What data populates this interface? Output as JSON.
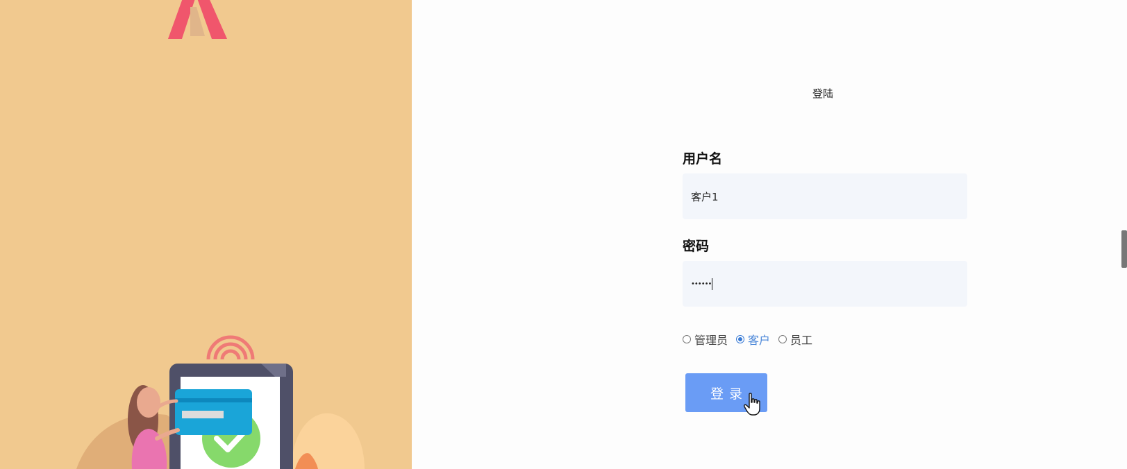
{
  "page": {
    "title": "登陆"
  },
  "form": {
    "username": {
      "label": "用户名",
      "value": "客户1"
    },
    "password": {
      "label": "密码",
      "masked_value": "••••••"
    },
    "roles": [
      {
        "label": "管理员",
        "selected": false
      },
      {
        "label": "客户",
        "selected": true
      },
      {
        "label": "员工",
        "selected": false
      }
    ],
    "submit_label": "登录"
  },
  "colors": {
    "left_panel_bg": "#f1c98f",
    "input_bg": "#f3f6fb",
    "button_bg": "#6a9cf5",
    "radio_selected": "#3a7bd5",
    "logo_red": "#f0566c"
  },
  "icons": [
    "logo-icon",
    "illustration",
    "hand-pointer-cursor-icon"
  ]
}
